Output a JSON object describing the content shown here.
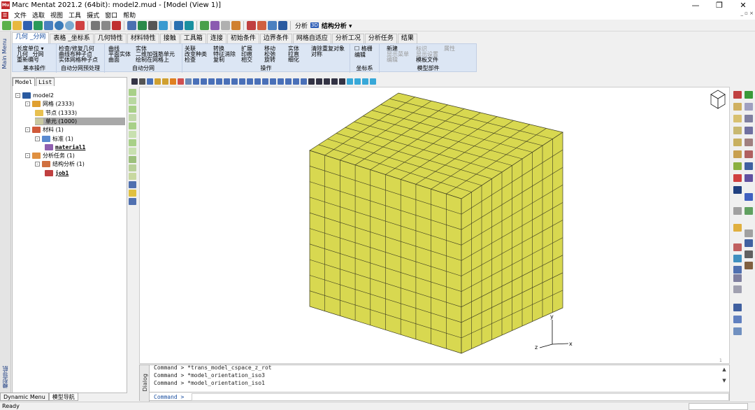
{
  "title": {
    "text": "Marc Mentat 2021.2 (64bit): model2.mud - [Model (View 1)]",
    "app_icon": "Mu",
    "minimize": "—",
    "maximize": "❐",
    "close": "✕"
  },
  "menubar": {
    "items": [
      "文件",
      "选取",
      "视图",
      "工具",
      "摄式",
      "窗口",
      "帮助"
    ],
    "mdi_controls": "_ ▫ ×"
  },
  "toolbar": {
    "analysis_label": "分析",
    "analysis_badge": "3D",
    "analysis_type": "结构分析 ▾"
  },
  "tabs": [
    "几何 _分网",
    "表格 _坐标系",
    "几何特性",
    "材料特性",
    "接触",
    "工具箱",
    "连接",
    "初始条件",
    "边界条件",
    "网格自适应",
    "分析工况",
    "分析任务",
    "结果"
  ],
  "ribbon": {
    "groups": [
      {
        "label": "基本操作",
        "items": [
          "长度单位 ▾",
          "几何 _分网",
          "重新编号"
        ]
      },
      {
        "label": "自动分网预处理",
        "items": [
          "检查/修复几何",
          "曲线布种子点",
          "实体网格种子点"
        ]
      },
      {
        "label": "自动分网",
        "items": [
          "曲线",
          "平面实体",
          "曲面",
          "实体",
          "二维加强筋单元",
          "绘制在网格上"
        ]
      },
      {
        "label": "操作",
        "items": [
          "关联",
          "改变种类",
          "检查",
          "转换",
          "特征消除",
          "复制",
          "扩展",
          "印痕",
          "相交",
          "移动",
          "松弛",
          "旋转",
          "实体",
          "拉直",
          "细化",
          "清除重复对象",
          "对称"
        ]
      },
      {
        "label": "坐标系",
        "items": [
          "格栅",
          "编辑"
        ]
      },
      {
        "label": "模型部件",
        "items": [
          "新建",
          "显示菜单",
          "编辑",
          "标识",
          "显示设置",
          "模板文件",
          "属性"
        ]
      }
    ]
  },
  "side_labels": {
    "main_menu": "Main Menu",
    "model_nav": "模型导航"
  },
  "panel": {
    "tabs": [
      "Model",
      "List"
    ],
    "tree": [
      {
        "label": "model2",
        "indent": 0,
        "toggle": "⊟"
      },
      {
        "label": "网格 (2333)",
        "indent": 1,
        "toggle": "⊟"
      },
      {
        "label": "节点 (1333)",
        "indent": 2,
        "toggle": ""
      },
      {
        "label": "单元 (1000)",
        "indent": 2,
        "toggle": "",
        "selected": true
      },
      {
        "label": "材料 (1)",
        "indent": 1,
        "toggle": "⊟"
      },
      {
        "label": "标准 (1)",
        "indent": 2,
        "toggle": "⊟"
      },
      {
        "label": "material1",
        "indent": 3,
        "toggle": "",
        "bold": true
      },
      {
        "label": "分析任务 (1)",
        "indent": 1,
        "toggle": "⊟"
      },
      {
        "label": "结构分析 (1)",
        "indent": 2,
        "toggle": "⊟"
      },
      {
        "label": "job1",
        "indent": 3,
        "toggle": "",
        "bold": true
      }
    ]
  },
  "viewport": {
    "cube_color": "#d8d850",
    "edge_color": "#3a3a20",
    "grid_divisions": 10,
    "axes": {
      "x": "x",
      "y": "y",
      "z": "z"
    },
    "page_number": "1"
  },
  "dialog": {
    "side_label": "Dialog",
    "lines": [
      "Command > *trans_model_cspace_z_rot",
      "Command > *model_orientation_iso3",
      "Command > *model_orientation_iso1"
    ],
    "prompt": "Command >"
  },
  "bottom_tabs": [
    "Dynamic Menu",
    "模型导航"
  ],
  "status": {
    "text": "Ready"
  },
  "colors": {
    "accent": "#1a4fa0",
    "ribbon": "#dce6f4",
    "app_red": "#c0282b"
  }
}
